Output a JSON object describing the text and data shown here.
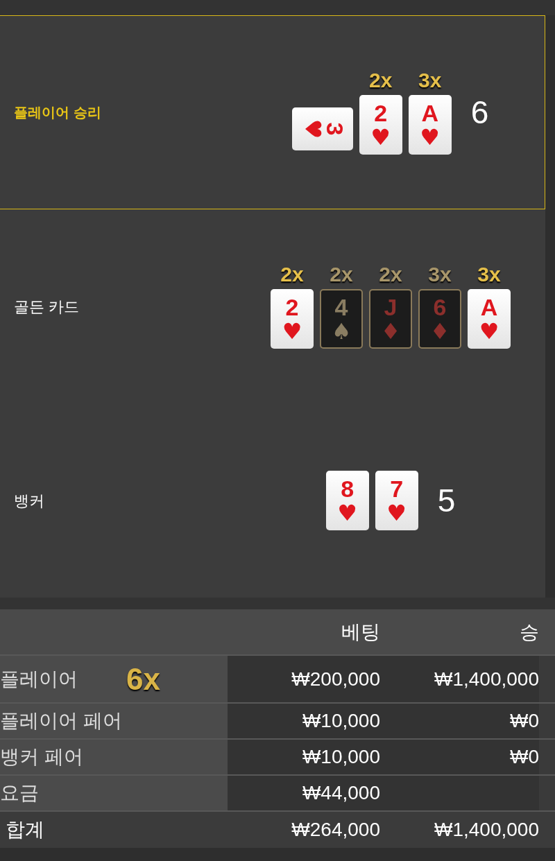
{
  "hands": [
    {
      "label": "플레이어 승리",
      "highlighted": true,
      "total": "6",
      "cards": [
        {
          "rank": "3",
          "suit": "♥",
          "kind": "face",
          "sideways": true
        },
        {
          "rank": "2",
          "suit": "♥",
          "kind": "face",
          "sideways": false,
          "multiplier": "2x"
        },
        {
          "rank": "A",
          "suit": "♥",
          "kind": "face",
          "sideways": false,
          "multiplier": "3x"
        }
      ]
    },
    {
      "label": "골든 카드",
      "highlighted": false,
      "cards": [
        {
          "rank": "2",
          "suit": "♥",
          "kind": "face",
          "sideways": false,
          "multiplier": "2x"
        },
        {
          "rank": "4",
          "suit": "♠",
          "kind": "dark_black",
          "sideways": false,
          "multiplier": "2x"
        },
        {
          "rank": "J",
          "suit": "♦",
          "kind": "dark",
          "sideways": false,
          "multiplier": "2x"
        },
        {
          "rank": "6",
          "suit": "♦",
          "kind": "dark",
          "sideways": false,
          "multiplier": "3x"
        },
        {
          "rank": "A",
          "suit": "♥",
          "kind": "face",
          "sideways": false,
          "multiplier": "3x"
        }
      ]
    },
    {
      "label": "뱅커",
      "highlighted": false,
      "total": "5",
      "cards": [
        {
          "rank": "8",
          "suit": "♥",
          "kind": "face",
          "sideways": false
        },
        {
          "rank": "7",
          "suit": "♥",
          "kind": "face",
          "sideways": false
        }
      ]
    }
  ],
  "table": {
    "columns": [
      "베팅",
      "승"
    ],
    "rows": [
      {
        "label": "플레이어",
        "multiplier": "6x",
        "bet": "₩200,000",
        "win": "₩1,400,000"
      },
      {
        "label": "플레이어 페어",
        "bet": "₩10,000",
        "win": "₩0"
      },
      {
        "label": "뱅커 페어",
        "bet": "₩10,000",
        "win": "₩0"
      },
      {
        "label": "요금",
        "bet": "₩44,000"
      }
    ],
    "total": {
      "label": "합계",
      "bet": "₩264,000",
      "win": "₩1,400,000"
    }
  }
}
